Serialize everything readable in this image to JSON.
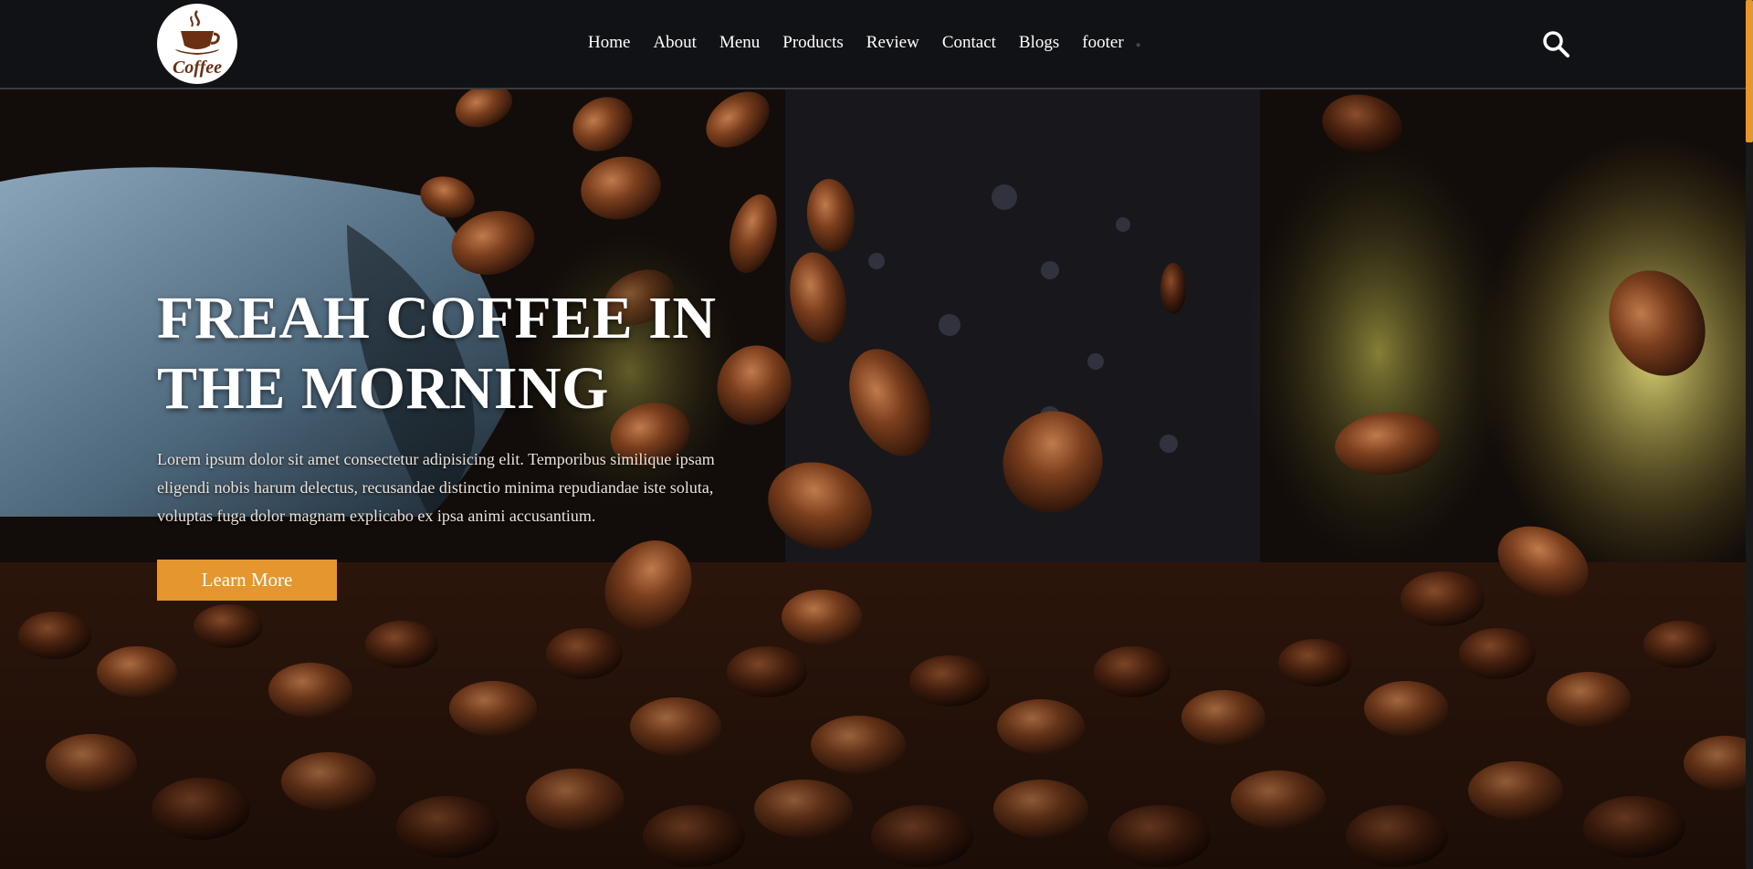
{
  "header": {
    "logo_text": "Coffee",
    "nav": {
      "items": [
        {
          "label": "Home"
        },
        {
          "label": "About"
        },
        {
          "label": "Menu"
        },
        {
          "label": "Products"
        },
        {
          "label": "Review"
        },
        {
          "label": "Contact"
        },
        {
          "label": "Blogs"
        },
        {
          "label": "footer"
        }
      ]
    },
    "search_icon": "search-icon"
  },
  "hero": {
    "title_line1": "FREAH COFFEE IN",
    "title_line2": "THE MORNING",
    "text": "Lorem ipsum dolor sit amet consectetur adipisicing elit. Temporibus similique ipsam eligendi nobis harum delectus, recusandae distinctio minima repudiandae iste soluta, voluptas fuga dolor magnam explicabo ex ipsa animi accusantium.",
    "button_label": "Learn More"
  },
  "colors": {
    "accent": "#e5962e",
    "header_bg": "#111216",
    "text": "#ffffff"
  }
}
